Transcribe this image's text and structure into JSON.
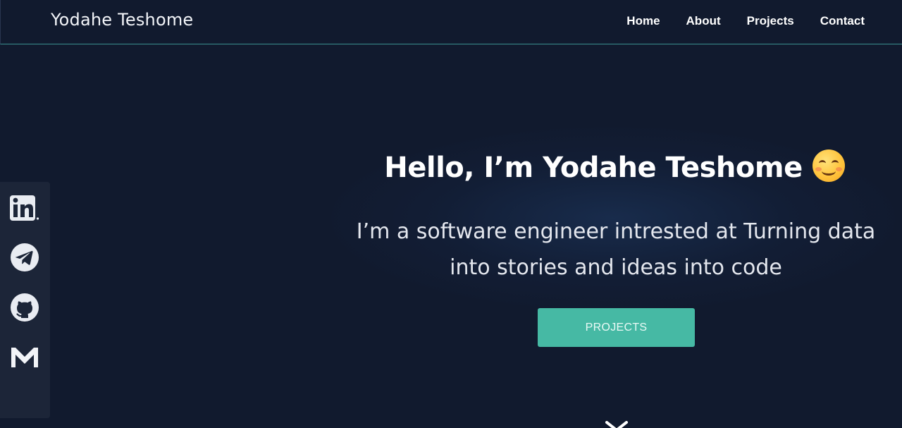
{
  "header": {
    "brand": "Yodahe Teshome",
    "nav": [
      "Home",
      "About",
      "Projects",
      "Contact"
    ]
  },
  "hero": {
    "title": "Hello, I’m Yodahe Teshome",
    "emoji": "smiling-face-icon",
    "subtitle_line1": "I’m a software engineer intrested at Turning data",
    "subtitle_line2": "into stories and ideas into code",
    "button_label": "PROJECTS"
  },
  "social": {
    "items": [
      "linkedin-icon",
      "telegram-icon",
      "github-icon",
      "gmail-icon"
    ]
  },
  "colors": {
    "background": "#111a2e",
    "accent": "#46b9a4",
    "sidebar": "#1c2538",
    "header_border": "#3a8f8f"
  }
}
